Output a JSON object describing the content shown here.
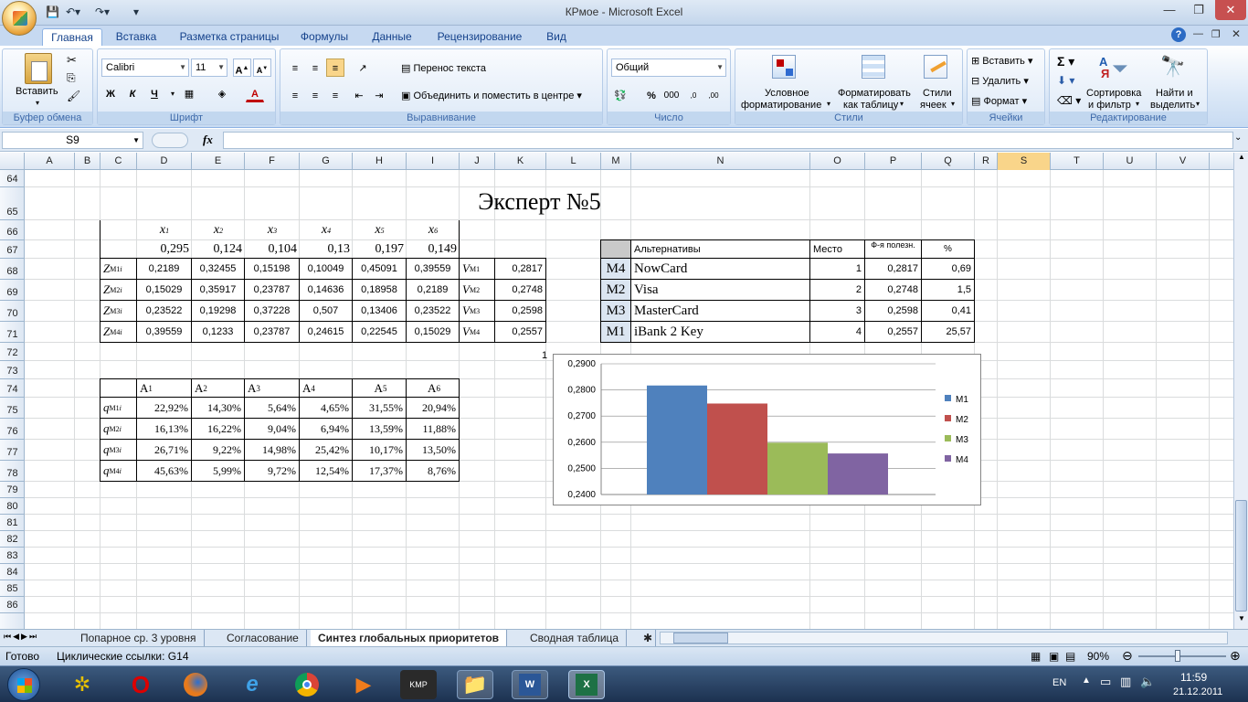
{
  "window": {
    "title": "КРмое - Microsoft Excel"
  },
  "tabs": [
    "Главная",
    "Вставка",
    "Разметка страницы",
    "Формулы",
    "Данные",
    "Рецензирование",
    "Вид"
  ],
  "ribbon": {
    "clipboard": {
      "label": "Буфер обмена",
      "paste": "Вставить"
    },
    "font": {
      "label": "Шрифт",
      "name": "Calibri",
      "size": "11",
      "bold": "Ж",
      "italic": "К",
      "underline": "Ч"
    },
    "align": {
      "label": "Выравнивание",
      "wrap": "Перенос текста",
      "merge": "Объединить и поместить в центре"
    },
    "number": {
      "label": "Число",
      "format": "Общий",
      "percent": "%",
      "thousands": "000"
    },
    "styles": {
      "label": "Стили",
      "cond1": "Условное",
      "cond2": "форматирование",
      "fmt1": "Форматировать",
      "fmt2": "как таблицу",
      "cell1": "Стили",
      "cell2": "ячеек"
    },
    "cells": {
      "label": "Ячейки",
      "insert": "Вставить",
      "delete": "Удалить",
      "format": "Формат"
    },
    "edit": {
      "label": "Редактирование",
      "sort1": "Сортировка",
      "sort2": "и фильтр",
      "find1": "Найти и",
      "find2": "выделить"
    }
  },
  "formula": {
    "namebox": "S9",
    "fx": "fx",
    "value": ""
  },
  "columns": [
    "A",
    "B",
    "C",
    "D",
    "E",
    "F",
    "G",
    "H",
    "I",
    "J",
    "K",
    "L",
    "M",
    "N",
    "O",
    "P",
    "Q",
    "R",
    "S",
    "T",
    "U",
    "V"
  ],
  "rows": [
    "64",
    "65",
    "66",
    "67",
    "68",
    "69",
    "70",
    "71",
    "72",
    "73",
    "74",
    "75",
    "76",
    "77",
    "78",
    "79",
    "80",
    "81",
    "82",
    "83",
    "84",
    "85",
    "86"
  ],
  "sheet": {
    "title": "Эксперт №5",
    "x_headers": [
      "x",
      "x",
      "x",
      "x",
      "x",
      "x"
    ],
    "x_subs": [
      "1",
      "2",
      "3",
      "4",
      "5",
      "6"
    ],
    "weights": [
      "0,295",
      "0,124",
      "0,104",
      "0,13",
      "0,197",
      "0,149"
    ],
    "z_label": "Z",
    "z_subs": [
      "i",
      "i",
      "i",
      "i"
    ],
    "z_sups": [
      "M1",
      "M2",
      "M3",
      "M4"
    ],
    "z_rows": [
      [
        "0,2189",
        "0,32455",
        "0,15198",
        "0,10049",
        "0,45091",
        "0,39559"
      ],
      [
        "0,15029",
        "0,35917",
        "0,23787",
        "0,14636",
        "0,18958",
        "0,2189"
      ],
      [
        "0,23522",
        "0,19298",
        "0,37228",
        "0,507",
        "0,13406",
        "0,23522"
      ],
      [
        "0,39559",
        "0,1233",
        "0,23787",
        "0,24615",
        "0,22545",
        "0,15029"
      ]
    ],
    "v_label": "V",
    "v_sups": [
      "M1",
      "M2",
      "M3",
      "M4"
    ],
    "v_values": [
      "0,2817",
      "0,2748",
      "0,2598",
      "0,2557"
    ],
    "a_label": "A",
    "a_subs": [
      "1",
      "2",
      "3",
      "4",
      "5",
      "6"
    ],
    "q_label": "q",
    "q_sub": "i",
    "q_sups": [
      "M1",
      "M2",
      "M3",
      "M4"
    ],
    "q_rows": [
      [
        "22,92%",
        "14,30%",
        "5,64%",
        "4,65%",
        "31,55%",
        "20,94%"
      ],
      [
        "16,13%",
        "16,22%",
        "9,04%",
        "6,94%",
        "13,59%",
        "11,88%"
      ],
      [
        "26,71%",
        "9,22%",
        "14,98%",
        "25,42%",
        "10,17%",
        "13,50%"
      ],
      [
        "45,63%",
        "5,99%",
        "9,72%",
        "12,54%",
        "17,37%",
        "8,76%"
      ]
    ],
    "rank_headers": {
      "alt": "Альтернативы",
      "place": "Место",
      "util": "Ф-я полезн.",
      "pct": "%"
    },
    "rank_rows": [
      {
        "code": "M4",
        "name": "NowCard",
        "place": "1",
        "util": "0,2817",
        "pct": "0,69"
      },
      {
        "code": "M2",
        "name": "Visa",
        "place": "2",
        "util": "0,2748",
        "pct": "1,5"
      },
      {
        "code": "M3",
        "name": "MasterCard",
        "place": "3",
        "util": "0,2598",
        "pct": "0,41"
      },
      {
        "code": "M1",
        "name": "iBank 2 Key",
        "place": "4",
        "util": "0,2557",
        "pct": "25,57"
      }
    ],
    "chart_corner_label": "1"
  },
  "chart_data": {
    "type": "bar",
    "categories": [
      "1"
    ],
    "series": [
      {
        "name": "M1",
        "values": [
          0.2817
        ],
        "color": "#4f81bd"
      },
      {
        "name": "M2",
        "values": [
          0.2748
        ],
        "color": "#c0504d"
      },
      {
        "name": "M3",
        "values": [
          0.2598
        ],
        "color": "#9bbb59"
      },
      {
        "name": "M4",
        "values": [
          0.2557
        ],
        "color": "#8064a2"
      }
    ],
    "ylim": [
      0.24,
      0.29
    ],
    "yticks": [
      "0,2400",
      "0,2500",
      "0,2600",
      "0,2700",
      "0,2800",
      "0,2900"
    ],
    "legend": "right",
    "grid": true
  },
  "sheettabs": [
    "Попарное ср. 3 уровня",
    "Согласование",
    "Синтез глобальных приоритетов",
    "Сводная таблица"
  ],
  "status": {
    "ready": "Готово",
    "circular": "Циклические ссылки: G14",
    "zoom": "90%"
  },
  "taskbar": {
    "lang": "EN",
    "time": "11:59",
    "date": "21.12.2011"
  }
}
